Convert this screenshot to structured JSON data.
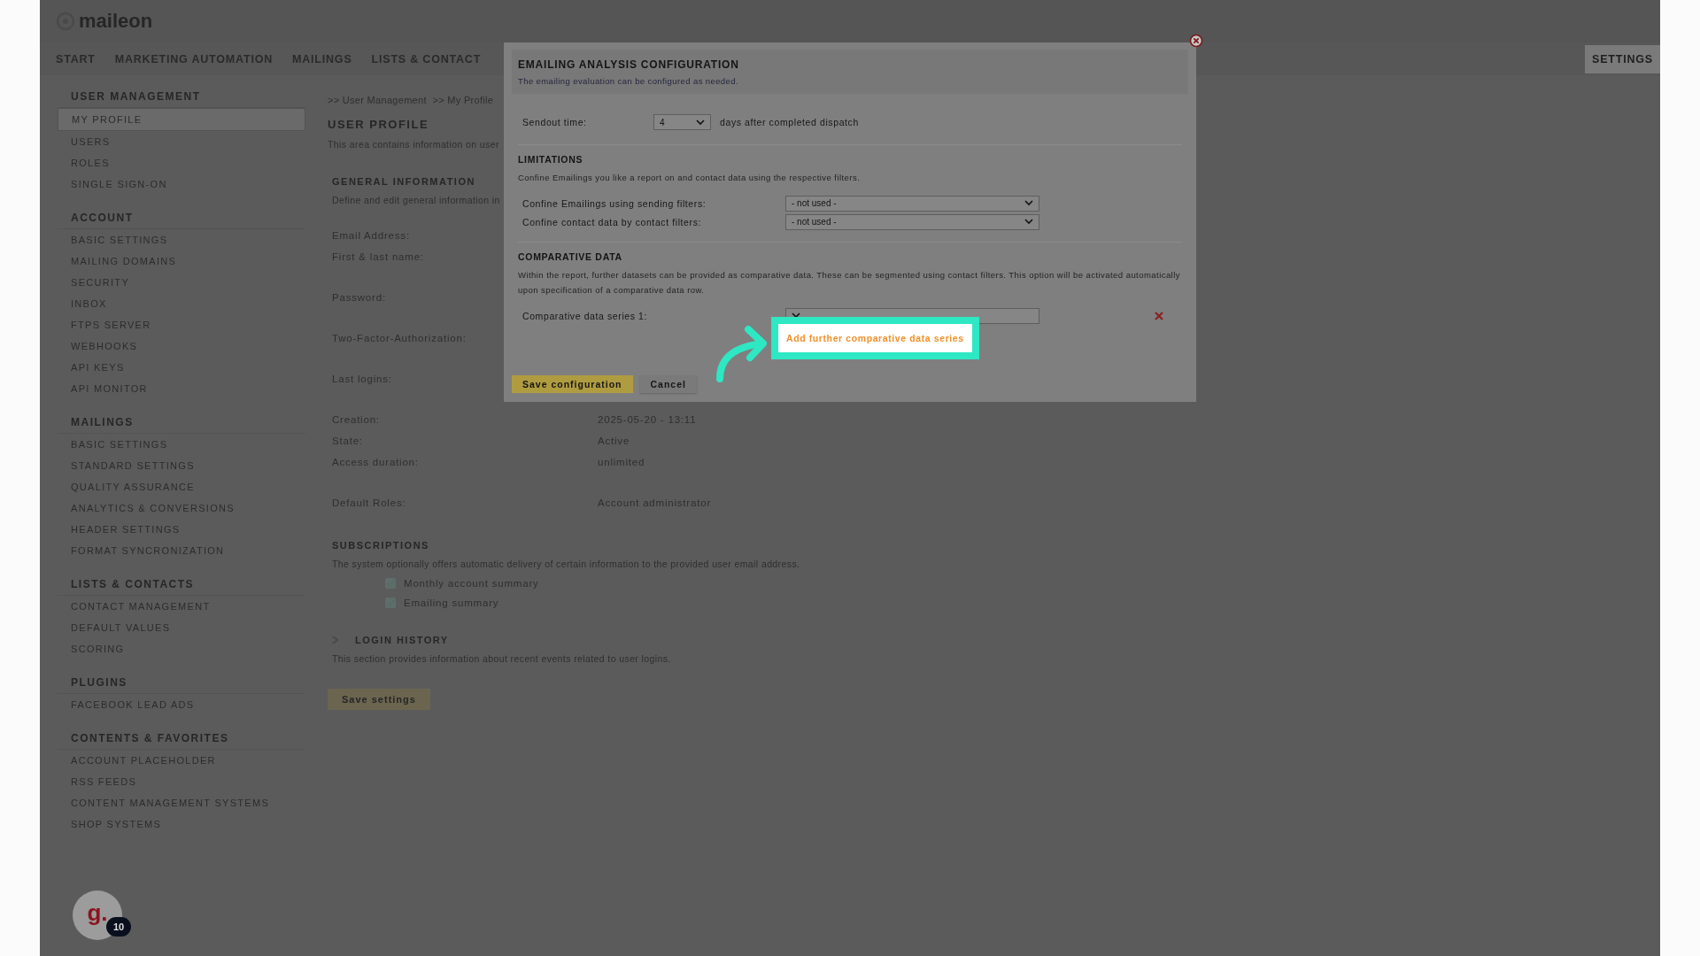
{
  "header": {
    "logo": "maileon",
    "nav": [
      {
        "label": "START",
        "selected": false
      },
      {
        "label": "MARKETING AUTOMATION",
        "selected": false
      },
      {
        "label": "MAILINGS",
        "selected": false
      },
      {
        "label": "LISTS & CONTACT",
        "selected": false
      }
    ],
    "right_nav": [
      {
        "label": "SETTINGS",
        "selected": true
      }
    ]
  },
  "sidebar": [
    {
      "title": "USER MANAGEMENT",
      "items": [
        {
          "label": "MY PROFILE",
          "selected": true
        },
        {
          "label": "USERS",
          "selected": false
        },
        {
          "label": "ROLES",
          "selected": false
        },
        {
          "label": "SINGLE SIGN-ON",
          "selected": false
        }
      ]
    },
    {
      "title": "ACCOUNT",
      "items": [
        {
          "label": "BASIC SETTINGS",
          "selected": false
        },
        {
          "label": "MAILING DOMAINS",
          "selected": false
        },
        {
          "label": "SECURITY",
          "selected": false
        },
        {
          "label": "INBOX",
          "selected": false
        },
        {
          "label": "FTPS SERVER",
          "selected": false
        },
        {
          "label": "WEBHOOKS",
          "selected": false
        },
        {
          "label": "API KEYS",
          "selected": false
        },
        {
          "label": "API MONITOR",
          "selected": false
        }
      ]
    },
    {
      "title": "MAILINGS",
      "items": [
        {
          "label": "BASIC SETTINGS",
          "selected": false
        },
        {
          "label": "STANDARD SETTINGS",
          "selected": false
        },
        {
          "label": "QUALITY ASSURANCE",
          "selected": false
        },
        {
          "label": "ANALYTICS & CONVERSIONS",
          "selected": false
        },
        {
          "label": "HEADER SETTINGS",
          "selected": false
        },
        {
          "label": "FORMAT SYNCRONIZATION",
          "selected": false
        }
      ]
    },
    {
      "title": "LISTS & CONTACTS",
      "items": [
        {
          "label": "CONTACT MANAGEMENT",
          "selected": false
        },
        {
          "label": "DEFAULT VALUES",
          "selected": false
        },
        {
          "label": "SCORING",
          "selected": false
        }
      ]
    },
    {
      "title": "PLUGINS",
      "items": [
        {
          "label": "FACEBOOK LEAD ADS",
          "selected": false
        }
      ]
    },
    {
      "title": "CONTENTS & FAVORITES",
      "items": [
        {
          "label": "ACCOUNT PLACEHOLDER",
          "selected": false
        },
        {
          "label": "RSS FEEDS",
          "selected": false
        },
        {
          "label": "CONTENT MANAGEMENT SYSTEMS",
          "selected": false
        },
        {
          "label": "SHOP SYSTEMS",
          "selected": false
        }
      ]
    }
  ],
  "content": {
    "breadcrumb": ">> User Management  >> My Profile",
    "title": "USER PROFILE",
    "description": "This area contains information on user",
    "general": {
      "title": "GENERAL INFORMATION",
      "description": "Define and edit general information in",
      "field_groups": [
        [
          {
            "label": "Email Address:"
          },
          {
            "label": "First & last name:"
          }
        ],
        [
          {
            "label": "Password:"
          }
        ],
        [
          {
            "label": "Two-Factor-Authorization:"
          }
        ],
        [
          {
            "label": "Last logins:"
          }
        ],
        [
          {
            "label": "Creation:",
            "value": "2025-05-20 - 13:11"
          },
          {
            "label": "State:",
            "value": "Active"
          },
          {
            "label": "Access duration:",
            "value": "unlimited"
          }
        ],
        [
          {
            "label": "Default Roles:",
            "value": "Account administrator"
          }
        ]
      ]
    },
    "subscriptions": {
      "title": "SUBSCRIPTIONS",
      "description": "The system optionally offers automatic delivery of certain information to the provided user email address.",
      "options": [
        {
          "label": "Monthly account summary",
          "checked": true
        },
        {
          "label": "Emailing summary",
          "checked": true
        }
      ]
    },
    "login_history": {
      "title": "LOGIN HISTORY",
      "expanded": false,
      "description": "This section provides information about recent events related to user logins."
    },
    "save_button": "Save settings"
  },
  "dialog": {
    "title": "EMAILING ANALYSIS CONFIGURATION",
    "subtitle": "The emailing evaluation can be configured as needed.",
    "sendout": {
      "label": "Sendout time:",
      "value": "4",
      "suffix": "days after completed dispatch"
    },
    "sections": [
      {
        "title": "LIMITATIONS",
        "description": "Confine Emailings you like a report on and contact data using the respective filters.",
        "rows": [
          {
            "label": "Confine Emailings using sending filters:",
            "value": "- not used -",
            "removable": false
          },
          {
            "label": "Confine contact data by contact filters:",
            "value": "- not used -",
            "removable": false
          }
        ]
      },
      {
        "title": "COMPARATIVE DATA",
        "description": "Within the report, further datasets can be provided as comparative data. These can be segmented using contact filters. This option will be activated automatically upon specification of a comparative data row.",
        "rows": [
          {
            "label": "Comparative data series 1:",
            "removable": true
          }
        ]
      }
    ],
    "add_link": "Add further comparative data series",
    "buttons": [
      {
        "label": "Save configuration",
        "kind": "primary"
      },
      {
        "label": "Cancel",
        "kind": "secondary"
      }
    ]
  },
  "widget": {
    "logo": "g.",
    "badge": "10"
  }
}
